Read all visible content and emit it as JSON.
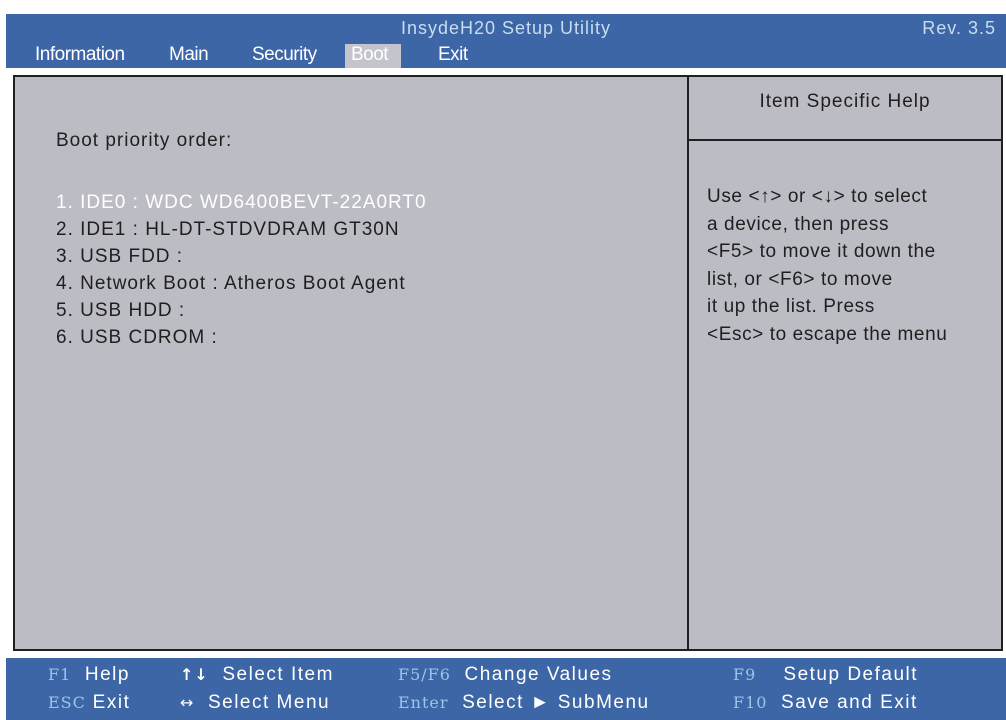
{
  "title": {
    "app": "InsydeH20 Setup Utility",
    "revision": "Rev. 3.5"
  },
  "menu": {
    "tabs": [
      {
        "label": "Information"
      },
      {
        "label": "Main"
      },
      {
        "label": "Security"
      },
      {
        "label": "Boot",
        "active": true
      },
      {
        "label": "Exit"
      }
    ]
  },
  "boot": {
    "heading": "Boot priority order:",
    "items": [
      {
        "label": "1. IDE0 : WDC WD6400BEVT-22A0RT0",
        "selected": true
      },
      {
        "label": "2. IDE1 : HL-DT-STDVDRAM GT30N"
      },
      {
        "label": "3. USB FDD :"
      },
      {
        "label": "4. Network Boot : Atheros Boot Agent"
      },
      {
        "label": "5. USB HDD :"
      },
      {
        "label": "6. USB CDROM :"
      }
    ]
  },
  "help": {
    "title": "Item Specific Help",
    "lines": [
      "Use <↑> or <↓> to select",
      "a device, then press",
      "<F5> to move it down the",
      "list, or <F6> to move",
      "it up the list. Press",
      "<Esc> to escape the menu"
    ]
  },
  "footer": {
    "keys": [
      {
        "key": "F1",
        "desc": "Help"
      },
      {
        "key": "ESC",
        "desc": "Exit"
      },
      {
        "key": "↑↓",
        "desc": "Select Item"
      },
      {
        "key": "↔",
        "desc": "Select Menu"
      },
      {
        "key": "F5/F6",
        "desc": "Change Values"
      },
      {
        "key": "Enter",
        "desc": "Select ► SubMenu"
      },
      {
        "key": "F9",
        "desc": "Setup Default"
      },
      {
        "key": "F10",
        "desc": "Save and Exit"
      }
    ]
  },
  "colors": {
    "bar_blue": "#3d66a6",
    "panel_gray": "#bcbcc4",
    "key_blue": "#9fc3ea"
  }
}
